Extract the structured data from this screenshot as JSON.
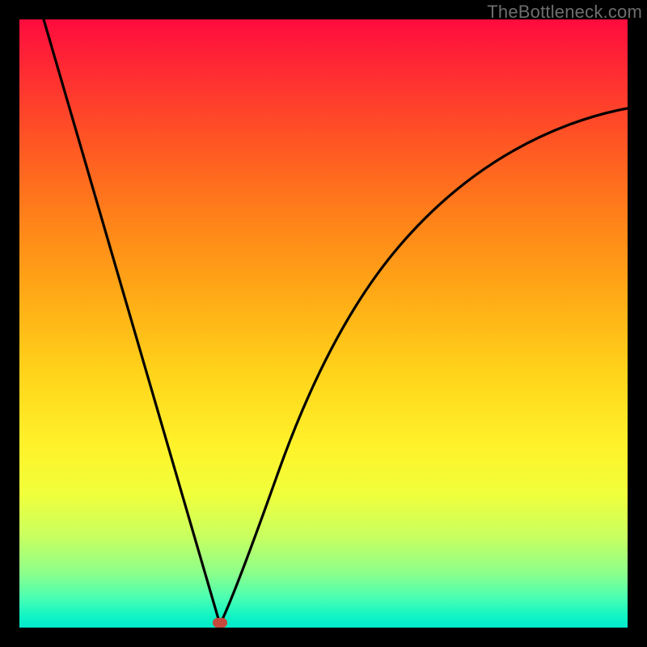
{
  "watermark": "TheBottleneck.com",
  "chart_data": {
    "type": "line",
    "title": "",
    "xlabel": "",
    "ylabel": "",
    "xlim": [
      0,
      100
    ],
    "ylim": [
      0,
      100
    ],
    "series": [
      {
        "name": "left-branch",
        "x": [
          4,
          8,
          12,
          16,
          20,
          24,
          28,
          31,
          33
        ],
        "values": [
          100,
          85,
          70,
          55,
          40,
          25,
          12,
          3,
          0
        ]
      },
      {
        "name": "right-branch",
        "x": [
          33,
          36,
          40,
          45,
          50,
          56,
          63,
          71,
          80,
          90,
          100
        ],
        "values": [
          0,
          10,
          25,
          40,
          52,
          62,
          70,
          76,
          80,
          83,
          85
        ]
      }
    ],
    "marker": {
      "x": 33,
      "y": 0,
      "color": "#c54a3d"
    },
    "grid": false,
    "legend": false
  }
}
